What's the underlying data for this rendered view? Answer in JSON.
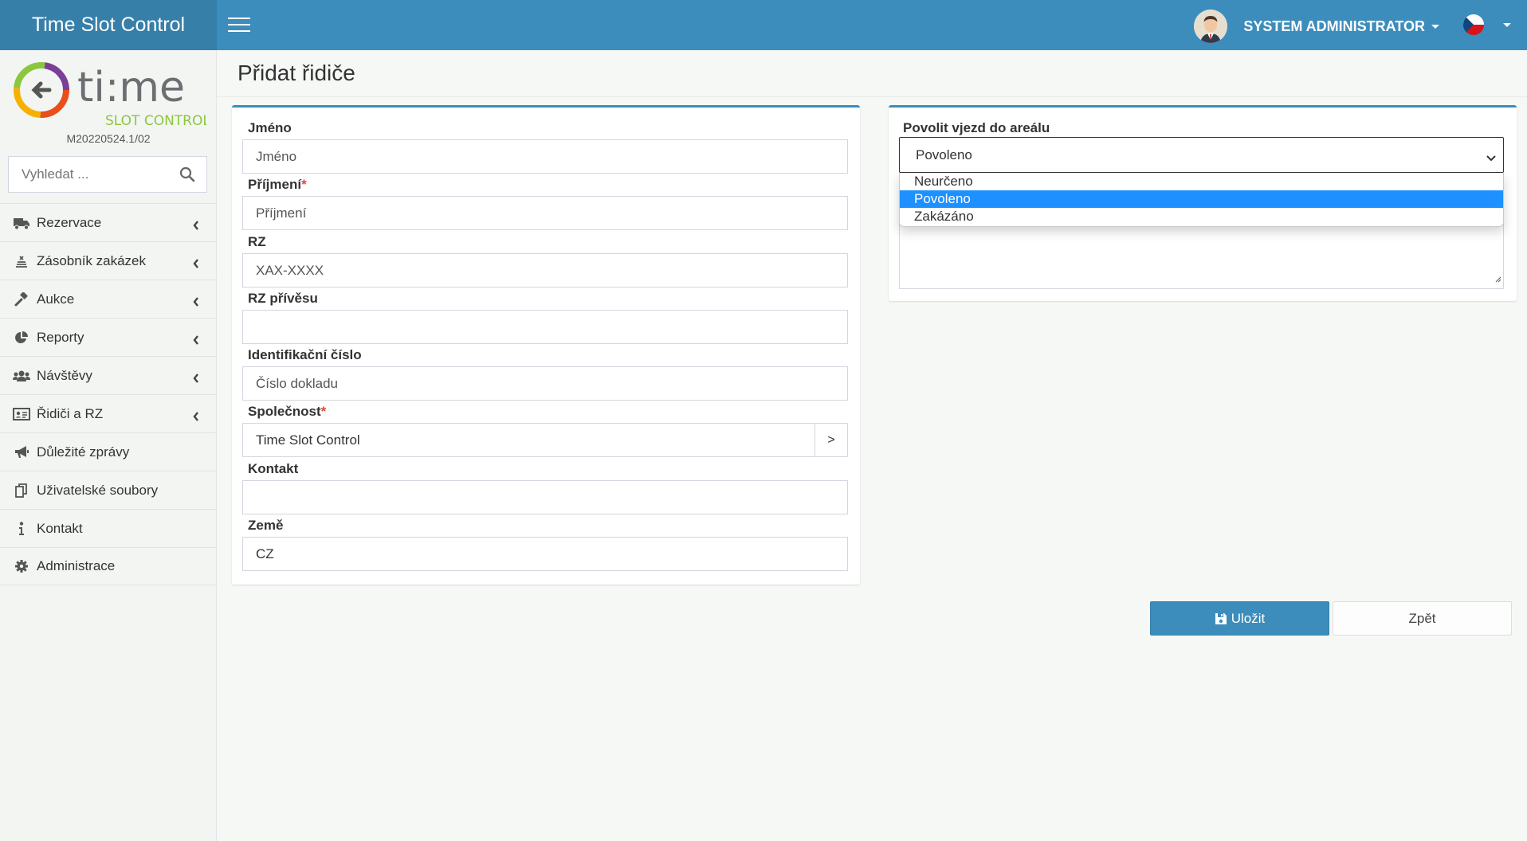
{
  "app": {
    "title": "Time Slot Control"
  },
  "header": {
    "user_name": "SYSTEM ADMINISTRATOR",
    "language_icon": "czech-flag-icon"
  },
  "sidebar": {
    "logo_text": "ti:me",
    "logo_subtext": "SLOT CONTROL",
    "version": "M20220524.1/02",
    "search_placeholder": "Vyhledat ...",
    "items": [
      {
        "label": "Rezervace",
        "icon": "truck-icon",
        "has_submenu": true
      },
      {
        "label": "Zásobník zakázek",
        "icon": "stack-icon",
        "has_submenu": true
      },
      {
        "label": "Aukce",
        "icon": "gavel-icon",
        "has_submenu": true
      },
      {
        "label": "Reporty",
        "icon": "pie-chart-icon",
        "has_submenu": true
      },
      {
        "label": "Návštěvy",
        "icon": "users-icon",
        "has_submenu": true
      },
      {
        "label": "Řidiči a RZ",
        "icon": "id-card-icon",
        "has_submenu": true
      },
      {
        "label": "Důležité zprávy",
        "icon": "megaphone-icon",
        "has_submenu": false
      },
      {
        "label": "Uživatelské soubory",
        "icon": "files-icon",
        "has_submenu": false
      },
      {
        "label": "Kontakt",
        "icon": "info-icon",
        "has_submenu": false
      },
      {
        "label": "Administrace",
        "icon": "gear-icon",
        "has_submenu": false
      }
    ]
  },
  "page": {
    "title": "Přidat řidiče"
  },
  "form": {
    "first_name": {
      "label": "Jméno",
      "placeholder": "Jméno",
      "value": ""
    },
    "last_name": {
      "label": "Příjmení",
      "required_mark": "*",
      "placeholder": "Příjmení",
      "value": ""
    },
    "plate": {
      "label": "RZ",
      "placeholder": "XAX-XXXX",
      "value": ""
    },
    "trailer_plate": {
      "label": "RZ přívěsu",
      "placeholder": "",
      "value": ""
    },
    "id_number": {
      "label": "Identifikační číslo",
      "placeholder": "Číslo dokladu",
      "value": ""
    },
    "company": {
      "label": "Společnost",
      "required_mark": "*",
      "value": "Time Slot Control",
      "button": ">"
    },
    "contact": {
      "label": "Kontakt",
      "placeholder": "",
      "value": ""
    },
    "country": {
      "label": "Země",
      "value": "CZ"
    }
  },
  "entry": {
    "label": "Povolit vjezd do areálu",
    "selected": "Povoleno",
    "options": [
      "Neurčeno",
      "Povoleno",
      "Zakázáno"
    ]
  },
  "actions": {
    "save_label": "Uložit",
    "back_label": "Zpět"
  },
  "colors": {
    "primary": "#3c8dbc",
    "primary_dark": "#367fa9",
    "highlight": "#1e90ff",
    "required": "#dd4b39"
  }
}
